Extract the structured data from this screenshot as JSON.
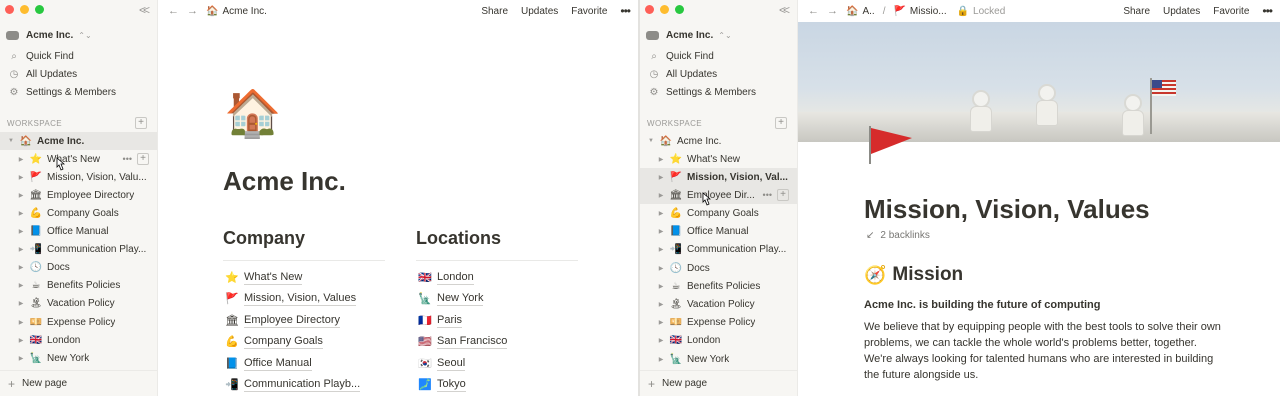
{
  "window1": {
    "workspace_name": "Acme Inc.",
    "nav": [
      {
        "label": "Quick Find",
        "icon": "search-icon"
      },
      {
        "label": "All Updates",
        "icon": "clock-icon"
      },
      {
        "label": "Settings & Members",
        "icon": "gear-icon"
      }
    ],
    "section_label": "WORKSPACE",
    "tree_root": {
      "emoji": "🏠",
      "label": "Acme Inc."
    },
    "tree_children": [
      {
        "emoji": "⭐",
        "label": "What's New"
      },
      {
        "emoji": "🚩",
        "label": "Mission, Vision, Valu..."
      },
      {
        "emoji": "🏛",
        "label": "Employee Directory"
      },
      {
        "emoji": "💪",
        "label": "Company Goals"
      },
      {
        "emoji": "📘",
        "label": "Office Manual"
      },
      {
        "emoji": "📲",
        "label": "Communication Play..."
      },
      {
        "emoji": "🕓",
        "label": "Docs"
      },
      {
        "emoji": "☕",
        "label": "Benefits Policies"
      },
      {
        "emoji": "🏝",
        "label": "Vacation Policy"
      },
      {
        "emoji": "💴",
        "label": "Expense Policy"
      },
      {
        "emoji": "🇬🇧",
        "label": "London"
      },
      {
        "emoji": "🗽",
        "label": "New York"
      }
    ],
    "new_page": "New page",
    "topbar": {
      "page_emoji": "🏠",
      "page_title": "Acme Inc.",
      "share": "Share",
      "updates": "Updates",
      "favorite": "Favorite",
      "more": "•••"
    },
    "page": {
      "icon": "🏠",
      "title": "Acme Inc.",
      "company_heading": "Company",
      "locations_heading": "Locations",
      "company_links": [
        {
          "emoji": "⭐",
          "label": "What's New"
        },
        {
          "emoji": "🚩",
          "label": "Mission, Vision, Values"
        },
        {
          "emoji": "🏛",
          "label": "Employee Directory"
        },
        {
          "emoji": "💪",
          "label": "Company Goals"
        },
        {
          "emoji": "📘",
          "label": "Office Manual"
        },
        {
          "emoji": "📲",
          "label": "Communication Playb..."
        }
      ],
      "location_links": [
        {
          "emoji": "🇬🇧",
          "label": "London"
        },
        {
          "emoji": "🗽",
          "label": "New York"
        },
        {
          "emoji": "🇫🇷",
          "label": "Paris"
        },
        {
          "emoji": "🇺🇸",
          "label": "San Francisco"
        },
        {
          "emoji": "🇰🇷",
          "label": "Seoul"
        },
        {
          "emoji": "🗾",
          "label": "Tokyo"
        }
      ]
    }
  },
  "window2": {
    "workspace_name": "Acme Inc.",
    "nav": [
      {
        "label": "Quick Find",
        "icon": "search-icon"
      },
      {
        "label": "All Updates",
        "icon": "clock-icon"
      },
      {
        "label": "Settings & Members",
        "icon": "gear-icon"
      }
    ],
    "section_label": "WORKSPACE",
    "tree_root": {
      "emoji": "🏠",
      "label": "Acme Inc."
    },
    "tree_children": [
      {
        "emoji": "⭐",
        "label": "What's New"
      },
      {
        "emoji": "🚩",
        "label": "Mission, Vision, Val..."
      },
      {
        "emoji": "🏛",
        "label": "Employee Dir..."
      },
      {
        "emoji": "💪",
        "label": "Company Goals"
      },
      {
        "emoji": "📘",
        "label": "Office Manual"
      },
      {
        "emoji": "📲",
        "label": "Communication Play..."
      },
      {
        "emoji": "🕓",
        "label": "Docs"
      },
      {
        "emoji": "☕",
        "label": "Benefits Policies"
      },
      {
        "emoji": "🏝",
        "label": "Vacation Policy"
      },
      {
        "emoji": "💴",
        "label": "Expense Policy"
      },
      {
        "emoji": "🇬🇧",
        "label": "London"
      },
      {
        "emoji": "🗽",
        "label": "New York"
      }
    ],
    "new_page": "New page",
    "topbar": {
      "crumb1_emoji": "🏠",
      "crumb1": "A..",
      "sep": "/",
      "crumb2_emoji": "🚩",
      "crumb2": "Missio...",
      "locked": "Locked",
      "share": "Share",
      "updates": "Updates",
      "favorite": "Favorite",
      "more": "•••"
    },
    "page": {
      "title": "Mission, Vision, Values",
      "backlinks": "2 backlinks",
      "mission_emoji": "🧭",
      "mission_heading": "Mission",
      "subhead": "Acme Inc. is building the future of computing",
      "paragraph": "We believe that by equipping people with the best tools to solve their own problems, we can tackle the whole world's problems better, together. We're always looking for talented humans who are interested in building the future alongside us."
    }
  },
  "colors": {
    "sidebar_bg": "#f7f6f3",
    "text": "#37352f",
    "muted": "#9b9a97",
    "hover": "#e8e7e4"
  }
}
